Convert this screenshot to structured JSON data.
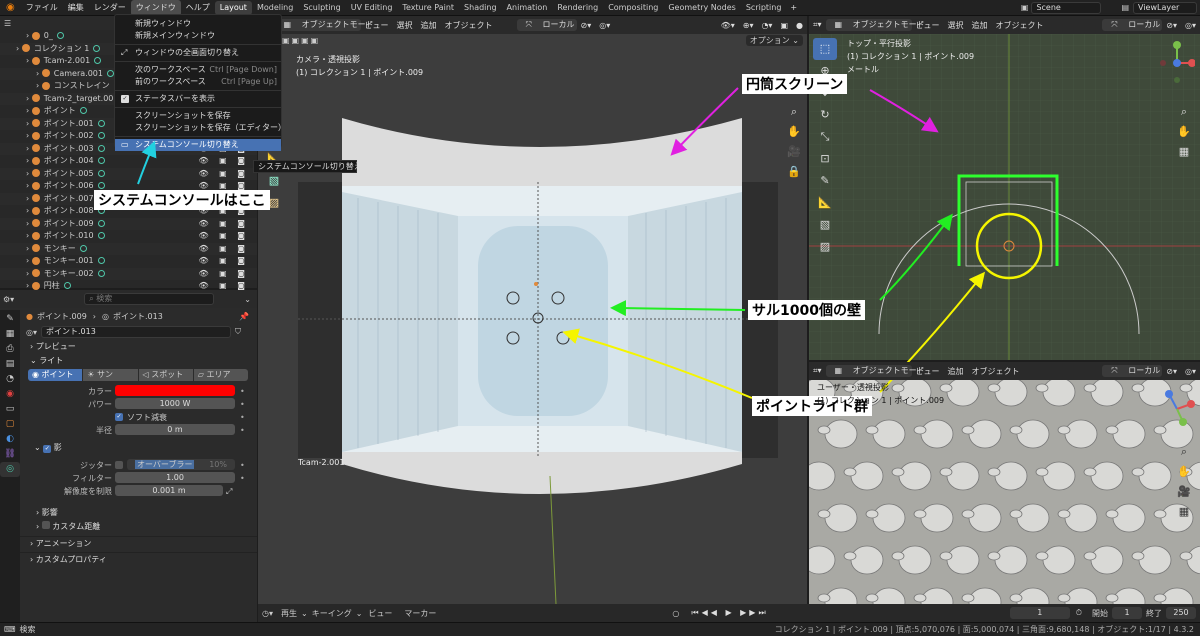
{
  "topbar": {
    "menus": [
      "ファイル",
      "編集",
      "レンダー",
      "ウィンドウ",
      "ヘルプ"
    ],
    "active_menu": "ウィンドウ",
    "workspaces": [
      "Layout",
      "Modeling",
      "Sculpting",
      "UV Editing",
      "Texture Paint",
      "Shading",
      "Animation",
      "Rendering",
      "Compositing",
      "Geometry Nodes",
      "Scripting"
    ],
    "active_workspace": "Layout",
    "scene": "Scene",
    "view_layer": "ViewLayer"
  },
  "window_menu": {
    "items": [
      {
        "label": "新規ウィンドウ",
        "shortcut": ""
      },
      {
        "label": "新規メインウィンドウ",
        "shortcut": ""
      },
      {
        "label": "ウィンドウの全画面切り替え",
        "shortcut": ""
      },
      {
        "label": "次のワークスペース",
        "shortcut": "Ctrl [Page Down]"
      },
      {
        "label": "前のワークスペース",
        "shortcut": "Ctrl [Page Up]"
      },
      {
        "label": "ステータスバーを表示",
        "shortcut": ""
      },
      {
        "label": "スクリーンショットを保存",
        "shortcut": ""
      },
      {
        "label": "スクリーンショットを保存（エディター）",
        "shortcut": ""
      },
      {
        "label": "システムコンソール切り替え",
        "shortcut": ""
      }
    ],
    "tooltip": "システムコンソール切り替え."
  },
  "outliner": {
    "search_placeholder": "検索",
    "rows": [
      {
        "label": "0_",
        "indent": 2
      },
      {
        "label": "コレクション 1",
        "indent": 1
      },
      {
        "label": "Tcam-2.001",
        "indent": 2
      },
      {
        "label": "Camera.001",
        "indent": 3
      },
      {
        "label": "コンストレイン",
        "indent": 3
      },
      {
        "label": "Tcam-2_target.00",
        "indent": 2
      },
      {
        "label": "ポイント",
        "indent": 2
      },
      {
        "label": "ポイント.001",
        "indent": 2
      },
      {
        "label": "ポイント.002",
        "indent": 2
      },
      {
        "label": "ポイント.003",
        "indent": 2
      },
      {
        "label": "ポイント.004",
        "indent": 2
      },
      {
        "label": "ポイント.005",
        "indent": 2
      },
      {
        "label": "ポイント.006",
        "indent": 2
      },
      {
        "label": "ポイント.007",
        "indent": 2
      },
      {
        "label": "ポイント.008",
        "indent": 2
      },
      {
        "label": "ポイント.009",
        "indent": 2,
        "selected": true
      },
      {
        "label": "ポイント.010",
        "indent": 2
      },
      {
        "label": "モンキー",
        "indent": 2
      },
      {
        "label": "モンキー.001",
        "indent": 2
      },
      {
        "label": "モンキー.002",
        "indent": 2
      },
      {
        "label": "円柱",
        "indent": 2
      }
    ]
  },
  "properties": {
    "search_placeholder": "検索",
    "breadcrumb_1": "ポイント.009",
    "breadcrumb_2": "ポイント.013",
    "datablock": "ポイント.013",
    "sec_preview": "プレビュー",
    "sec_light": "ライト",
    "light_types": [
      "ポイント",
      "サン",
      "スポット",
      "エリア"
    ],
    "color_label": "カラー",
    "color": "#ff0000",
    "power_label": "パワー",
    "power": "1000 W",
    "soft_falloff": "ソフト減衰",
    "radius_label": "半径",
    "radius": "0 m",
    "shadow": "影",
    "jitter_label": "ジッター",
    "overblur": "オーバーブラー",
    "overblur_value": "10%",
    "filter_label": "フィルター",
    "filter": "1.00",
    "resolution_label": "解像度を制限",
    "resolution": "0.001 m",
    "sec_influence": "影響",
    "sec_custom_distance": "カスタム距離",
    "sec_animation": "アニメーション",
    "sec_custom_props": "カスタムプロパティ"
  },
  "viewport_main": {
    "mode": "オブジェクトモード",
    "menus": [
      "ビュー",
      "選択",
      "追加",
      "オブジェクト"
    ],
    "transform": "ローカル",
    "options": "オプション",
    "view_name": "カメラ・透視投影",
    "view_sub": "(1) コレクション 1 | ポイント.009",
    "camera_label": "Tcam-2.001"
  },
  "viewport_top": {
    "mode": "オブジェクトモード",
    "menus": [
      "ビュー",
      "選択",
      "追加",
      "オブジェクト"
    ],
    "transform": "ローカル",
    "view_name": "トップ・平行投影",
    "view_sub": "(1) コレクション 1 | ポイント.009",
    "unit": "メートル"
  },
  "viewport_user": {
    "mode": "オブジェクトモード",
    "menus": [
      "ビュー",
      "追加",
      "オブジェクト"
    ],
    "transform": "ローカル",
    "view_name": "ユーザー・透視投影",
    "view_sub": "(1) コレクション 1 | ポイント.009"
  },
  "annotations": {
    "cylinder_screen": "円筒スクリーン",
    "console_here": "システムコンソールはここ",
    "monkey_wall": "サル1000個の壁",
    "point_lights": "ポイントライト群"
  },
  "timeline": {
    "playback": "再生",
    "keying": "キーイング",
    "view": "ビュー",
    "marker": "マーカー",
    "current_frame": "1",
    "start_label": "開始",
    "start": "1",
    "end_label": "終了",
    "end": "250"
  },
  "status": {
    "left": "検索",
    "right": "コレクション 1 | ポイント.009 | 頂点:5,070,076 | 面:5,000,074 | 三角面:9,680,148 | オブジェクト:1/17 | 4.3.2"
  },
  "colors": {
    "annotation_magenta": "#e020e0",
    "annotation_green": "#22ee22",
    "annotation_yellow": "#f5f500",
    "annotation_cyan": "#22d0e0",
    "selection": "#4772b3"
  }
}
